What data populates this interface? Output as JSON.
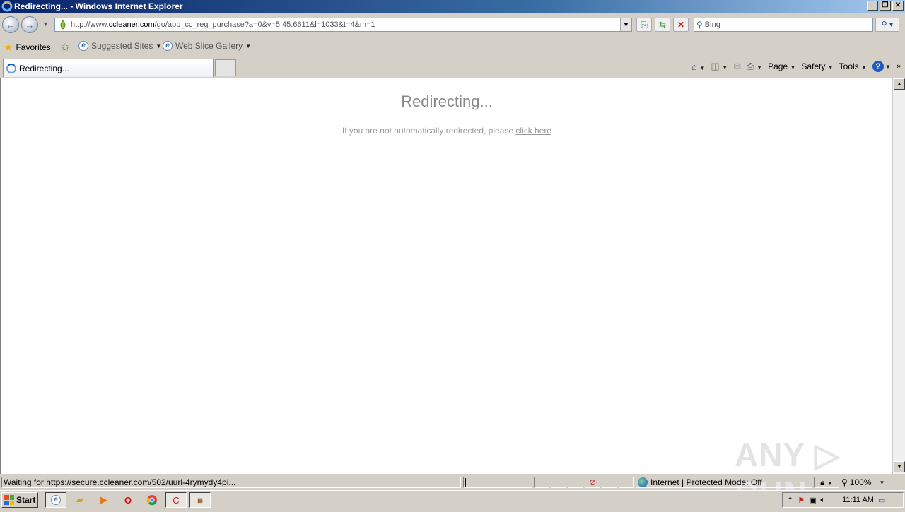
{
  "window": {
    "title": "Redirecting... - Windows Internet Explorer",
    "controls": [
      "_",
      "❐",
      "✕"
    ]
  },
  "address": {
    "url_prefix": "http://www.",
    "url_domain": "ccleaner.com",
    "url_rest": "/go/app_cc_reg_purchase?a=0&v=5.45.6611&l=1033&t=4&m=1"
  },
  "search": {
    "value": "Bing"
  },
  "favorites": {
    "favorites_label": "Favorites",
    "suggested_label": "Suggested Sites",
    "webslice_label": "Web Slice Gallery"
  },
  "tab": {
    "label": "Redirecting..."
  },
  "commandbar": {
    "page_label": "Page",
    "safety_label": "Safety",
    "tools_label": "Tools",
    "help_label": "?"
  },
  "page": {
    "heading": "Redirecting...",
    "message_prefix": "If you are not automatically redirected, please ",
    "link_text": "click here",
    "watermark": "ANY ▷ RUN"
  },
  "status": {
    "text": "Waiting for https://secure.ccleaner.com/502/uurl-4rymydy4pi...",
    "zone_text": "Internet | Protected Mode: Off",
    "zoom": "100%"
  },
  "taskbar": {
    "start_label": "Start",
    "clock": "11:11 AM"
  }
}
